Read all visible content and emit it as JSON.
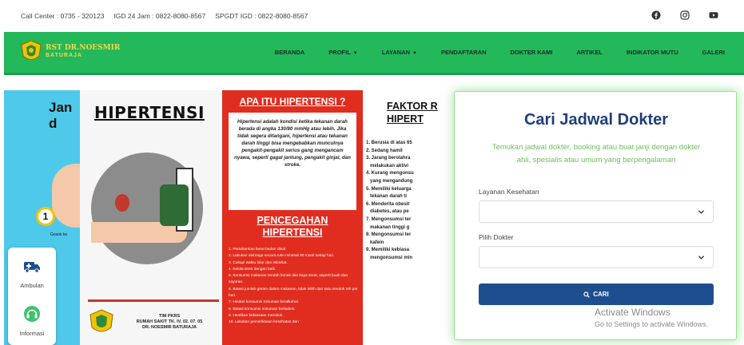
{
  "topbar": {
    "call_center": "Call Center : 0735 - 320123",
    "igd": "IGD 24 Jam : 0822-8080-8567",
    "spgdt": "SPGDT IGD : 0822-8080-8567",
    "social_icons": [
      "facebook-icon",
      "instagram-icon",
      "youtube-icon"
    ]
  },
  "nav": {
    "logo_line1": "RST DR.NOESMIR",
    "logo_line2": "BATURAJA",
    "items": [
      {
        "label": "BERANDA",
        "dropdown": false
      },
      {
        "label": "PROFIL",
        "dropdown": true
      },
      {
        "label": "LAYANAN",
        "dropdown": true
      },
      {
        "label": "PENDAFTARAN",
        "dropdown": false
      },
      {
        "label": "DOKTER KAMI",
        "dropdown": false
      },
      {
        "label": "ARTIKEL",
        "dropdown": false
      },
      {
        "label": "INDIKATOR MUTU",
        "dropdown": false
      },
      {
        "label": "GALERI",
        "dropdown": false
      }
    ]
  },
  "hero": {
    "panel1": {
      "title": "Jan\nd",
      "number": "1",
      "caption": "Gosok ke"
    },
    "panel2": {
      "title": "HIPERTENSI",
      "team": "TIM PKRS\nRUMAH SAKIT TK. IV. 02. 07. 05\nDR. NOESMIR BATURAJA"
    },
    "panel3": {
      "title": "APA ITU HIPERTENSI ?",
      "definition": "Hipertensi adalah kondisi ketika tekanan darah berada di angka 130/80 mmHg atau lebih. Jika tidak segera ditangani, hipertensi atau tekanan darah tinggi bisa mengebabkan munculnya pengakit-pengakit serius gang mengancam nyawa, seperti gagal jantung, pengakit ginjal, dan stroke.",
      "prevention_title": "PENCEGAHAN\nHIPERTENSI",
      "prevention_list": [
        "1. Pertahankan berat badan ideal.",
        "2. Lakukan olahraga secara rutin minimal 30 menit setiap hari.",
        "3. Cukupi waktu tidur dan istirahat.",
        "4. Kelola stres dengan baik.",
        "5. Konsumsi makanan rendah lemak dan kaya serat, seperti buah dan sayuran.",
        "6. Batasi jumlah garam dalam makanan, tidak lebih dari satu sendok teh per hari.",
        "7. Hindari konsumsi minuman beralkohol.",
        "8. Batasi konsumsi minuman berkafein.",
        "9. Hentikan kebiasaan merokok.",
        "10. Lakukan pemeriksaan kesehatan dan"
      ]
    },
    "panel4": {
      "title": "FAKTOR R\nHIPERT",
      "list": [
        "1. Berusia di atas 65",
        "2. Sedang hamil",
        "3. Jarang berolahra",
        "   melakukan aktivi",
        "4. Kurang mengonsu",
        "   yang mengandung",
        "5. Memiliki keluarga",
        "   tekanan darah ti",
        "6. Menderita obesit",
        "   diabetes, atau pe",
        "7. Mengonsumsi ter",
        "   makanan tinggi g",
        "8. Mengonsumsi ter",
        "   kafein",
        "9. Memiliki kebiasa",
        "   mengonsumsi min"
      ]
    }
  },
  "side": {
    "ambulance_label": "Ambulan",
    "info_label": "Informasi"
  },
  "search_card": {
    "title": "Cari Jadwal Dokter",
    "subtitle": "Temukan jadwal dokter, booking atau buat janji dengan dokter ahli, spesialis atau umum yang berpengalaman",
    "service_label": "Layanan Kesehatan",
    "service_value": "",
    "doctor_label": "Pilih Dokter",
    "doctor_value": "",
    "button_label": "CARI"
  },
  "watermark": {
    "line1": "Activate Windows",
    "line2": "Go to Settings to activate Windows."
  },
  "colors": {
    "nav_green": "#23b85a",
    "title_blue": "#1f3f7a",
    "button_blue": "#1f4e8f",
    "subtitle_green": "#6bbf59",
    "poster_red": "#e12d1f"
  }
}
